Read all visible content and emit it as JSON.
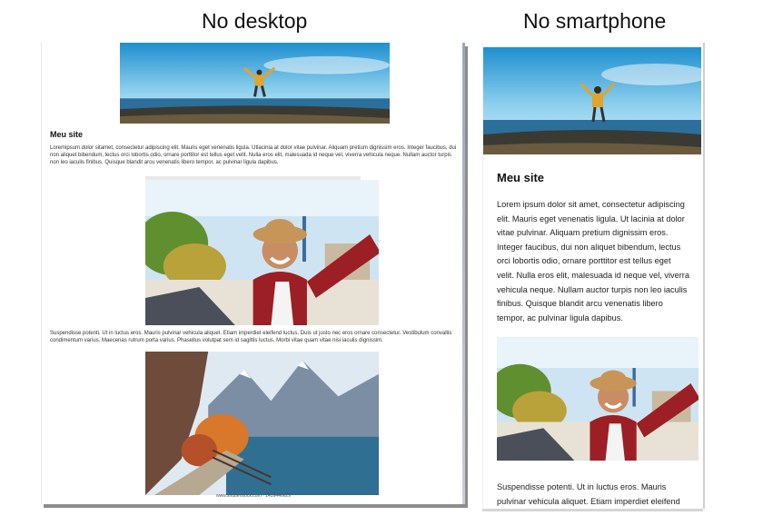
{
  "headings": {
    "desktop": "No desktop",
    "smartphone": "No smartphone"
  },
  "site": {
    "title": "Meu site",
    "paragraph1_desktop": "Loremipsum dolor sitamet, consectetur adipiscing elit. Mauris eget venenatis ligula. Utlacinia at dolor vitae pulvinar. Aliquam pretium dignissim eros. Integer faucibus, dui non aliquet bibendum, lectus orci lobortis odio, ornare porttitor est tellus eget velit. Nulla eros elit, malesuada id neque vel, viverra vehicula neque. Nullam auctor turpis non leo iaculis finibus. Quisque blandit arcu venenatis libero tempor, ac pulvinar ligula dapibus.",
    "paragraph1_phone": "Lorem ipsum dolor sit amet, consectetur adipiscing elit. Mauris eget venenatis ligula. Ut lacinia at dolor vitae pulvinar. Aliquam pretium dignissim eros. Integer faucibus, dui non aliquet bibendum, lectus orci lobortis odio, ornare porttitor est tellus eget velit. Nulla eros elit, malesuada id neque vel, viverra vehicula neque. Nullam auctor turpis non leo iaculis finibus. Quisque blandit arcu venenatis libero tempor, ac pulvinar ligula dapibus.",
    "paragraph2_desktop": "Suspendisse potenti. Ut in luctus eros. Mauris pulvinar vehicula aliquet. Etiam imperdiet eleifend luctus. Duis ut justo nec eros ornare consectetur. Vestibulum convallis condimentum varius. Maecenas rutrum porta varius. Phasellus volutpat sem id sagittis luctus. Morbi vitae quam vitae nisi iaculis dignissim.",
    "paragraph2_phone": "Suspendisse potenti. Ut in luctus eros. Mauris pulvinar vehicula aliquet. Etiam imperdiet eleifend",
    "watermark": "www.shutterstock.com · 1459446629"
  },
  "colors": {
    "sky": "#3aa7d8",
    "sea": "#1e5f86",
    "shirt": "#9b1f24",
    "hat": "#c89558"
  }
}
